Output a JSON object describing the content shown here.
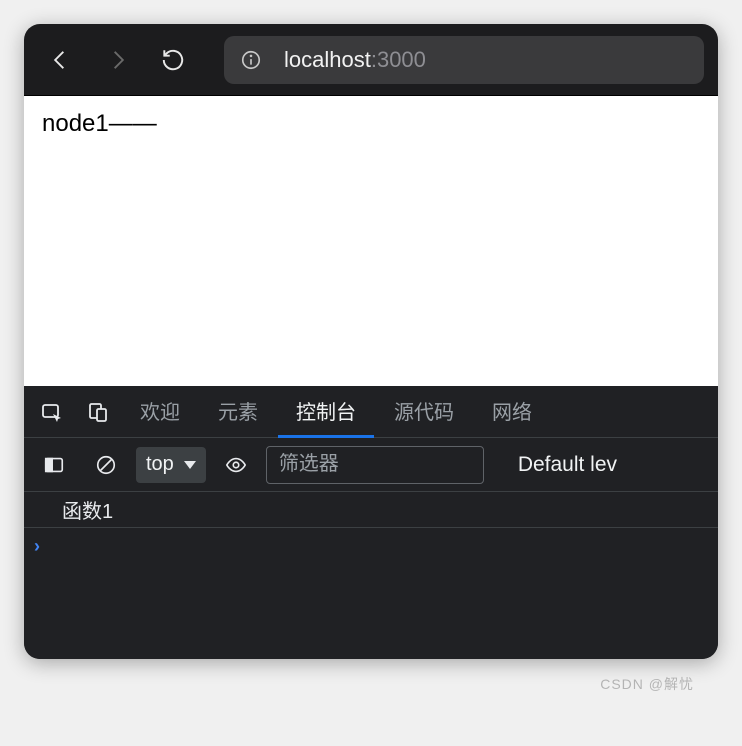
{
  "browser": {
    "address": {
      "host": "localhost",
      "port": ":3000"
    }
  },
  "page": {
    "content": "node1——"
  },
  "devtools": {
    "tabs": {
      "welcome": "欢迎",
      "elements": "元素",
      "console": "控制台",
      "sources": "源代码",
      "network": "网络"
    },
    "toolbar": {
      "context": "top",
      "filter_placeholder": "筛选器",
      "levels_label": "Default lev"
    },
    "console": {
      "message1": "函数1",
      "input_prompt": "›"
    }
  },
  "watermark": "CSDN @解忧"
}
